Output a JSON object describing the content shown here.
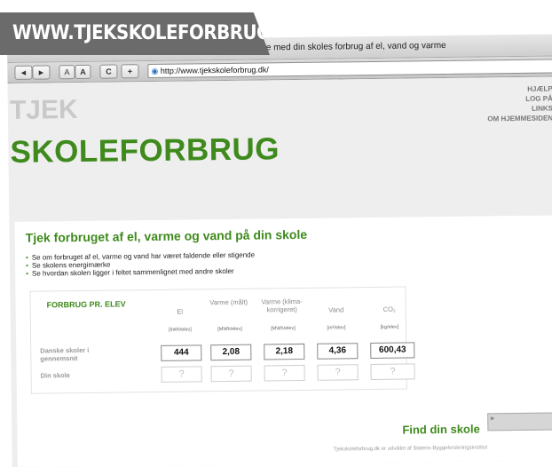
{
  "banner": {
    "text": "WWW.TJEKSKOLEFORBRUG.DK"
  },
  "browser": {
    "title": "Tjekskoleforbrug :: Hold øje med din skoles forbrug af el, vand og varme",
    "toolbar": {
      "back": "◄",
      "forward": "►",
      "text_small": "A",
      "text_large": "A",
      "reload": "C",
      "add": "+",
      "address": "http://www.tjekskoleforbrug.dk/"
    }
  },
  "site": {
    "logo_top": "TJEK",
    "logo_bottom": "SKOLEFORBRUG",
    "nav": [
      "HJÆLP",
      "LOG PÅ",
      "LINKS",
      "OM HJEMMESIDEN"
    ],
    "heading": "Tjek forbruget af el, varme og vand på din skole",
    "bullets": [
      "Se om forbruget af el, varme og vand har været faldende eller stigende",
      "Se skolens energimærke",
      "Se hvordan skolen ligger i feltet sammenlignet med andre skoler"
    ],
    "table": {
      "title": "FORBRUG PR. ELEV",
      "columns": [
        {
          "header": "El",
          "unit": "[kWh/elev]"
        },
        {
          "header": "Varme (målt)",
          "unit": "[MWh/elev]"
        },
        {
          "header": "Varme (klima-korrigeret)",
          "unit": "[MWh/elev]"
        },
        {
          "header": "Vand",
          "unit": "[m³/elev]"
        },
        {
          "header": "CO₂",
          "unit": "[kg/elev]"
        }
      ],
      "row1_label": "Danske skoler i gennemsnit",
      "row1_values": [
        "444",
        "2,08",
        "2,18",
        "4,36",
        "600,43"
      ],
      "row2_label": "Din skole",
      "row2_values": [
        "?",
        "?",
        "?",
        "?",
        "?"
      ]
    },
    "find_label": "Find din skole",
    "find_button": "»",
    "footer": "Tjekskoleforbrug.dk er udviklet af Statens Byggeforskningsinstitut"
  }
}
